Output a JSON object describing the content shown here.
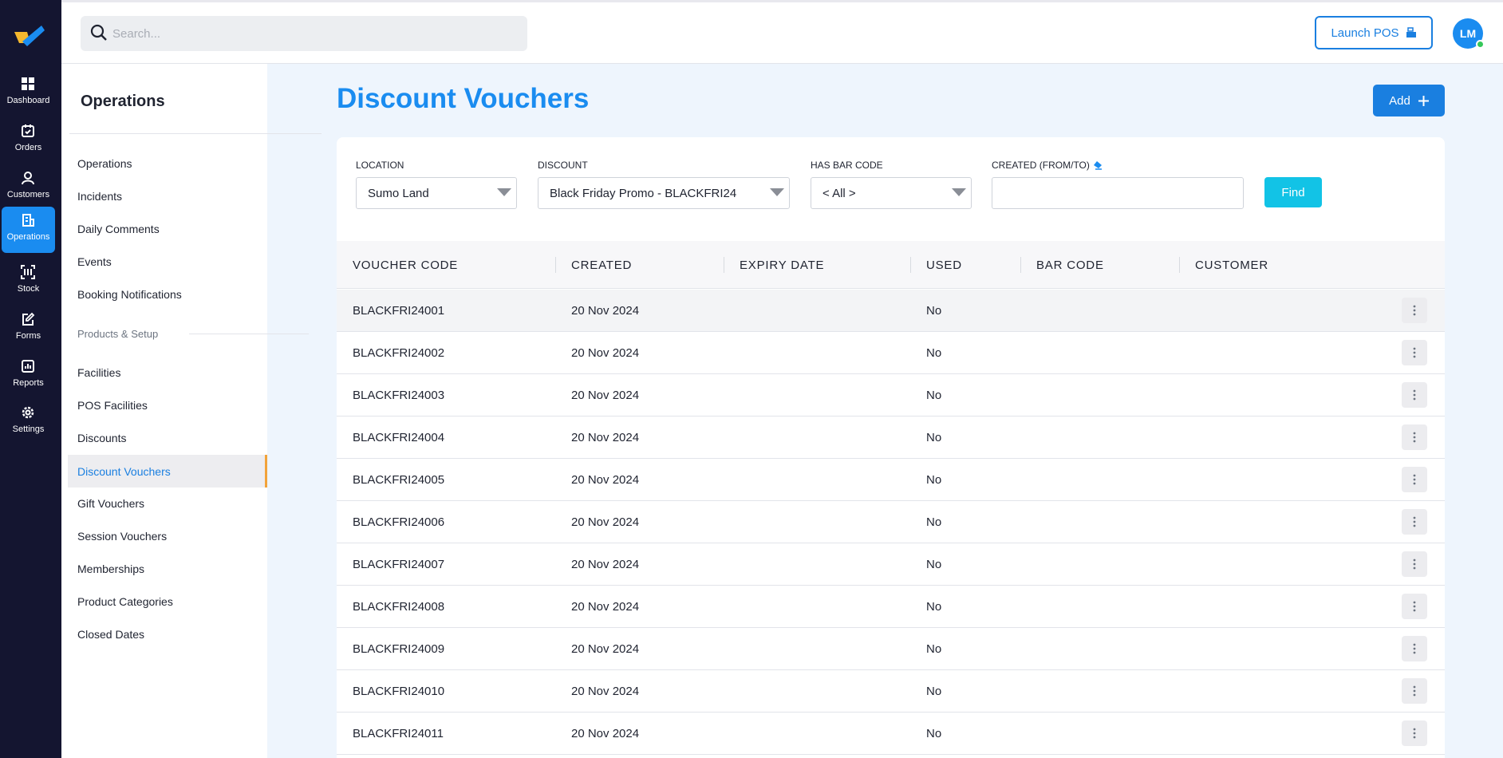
{
  "rail": {
    "items": [
      {
        "label": "Dashboard",
        "icon": "dashboard-icon"
      },
      {
        "label": "Orders",
        "icon": "orders-icon"
      },
      {
        "label": "Customers",
        "icon": "customers-icon"
      },
      {
        "label": "Operations",
        "icon": "operations-icon",
        "active": true
      },
      {
        "label": "Stock",
        "icon": "stock-icon"
      },
      {
        "label": "Forms",
        "icon": "forms-icon"
      },
      {
        "label": "Reports",
        "icon": "reports-icon"
      },
      {
        "label": "Settings",
        "icon": "settings-icon"
      }
    ]
  },
  "topbar": {
    "search_placeholder": "Search...",
    "launch_label": "Launch POS",
    "avatar_initials": "LM"
  },
  "subnav": {
    "title": "Operations",
    "items": [
      "Operations",
      "Incidents",
      "Daily Comments",
      "Events",
      "Booking Notifications"
    ],
    "section_label": "Products & Setup",
    "setup_items": [
      "Facilities",
      "POS Facilities",
      "Discounts",
      "Discount Vouchers",
      "Gift Vouchers",
      "Session Vouchers",
      "Memberships",
      "Product Categories",
      "Closed Dates"
    ],
    "active_item": "Discount Vouchers"
  },
  "main": {
    "title": "Discount Vouchers",
    "add_label": "Add"
  },
  "filters": {
    "location_label": "LOCATION",
    "location_value": "Sumo Land",
    "discount_label": "DISCOUNT",
    "discount_value": "Black Friday Promo - BLACKFRI24",
    "barcode_label": "HAS BAR CODE",
    "barcode_value": "< All >",
    "created_label": "CREATED (FROM/TO)",
    "created_value": "",
    "find_label": "Find"
  },
  "table": {
    "columns": [
      "VOUCHER CODE",
      "CREATED",
      "EXPIRY DATE",
      "USED",
      "BAR CODE",
      "CUSTOMER"
    ],
    "rows": [
      {
        "code": "BLACKFRI24001",
        "created": "20 Nov 2024",
        "expiry": "",
        "used": "No",
        "barcode": "",
        "customer": ""
      },
      {
        "code": "BLACKFRI24002",
        "created": "20 Nov 2024",
        "expiry": "",
        "used": "No",
        "barcode": "",
        "customer": ""
      },
      {
        "code": "BLACKFRI24003",
        "created": "20 Nov 2024",
        "expiry": "",
        "used": "No",
        "barcode": "",
        "customer": ""
      },
      {
        "code": "BLACKFRI24004",
        "created": "20 Nov 2024",
        "expiry": "",
        "used": "No",
        "barcode": "",
        "customer": ""
      },
      {
        "code": "BLACKFRI24005",
        "created": "20 Nov 2024",
        "expiry": "",
        "used": "No",
        "barcode": "",
        "customer": ""
      },
      {
        "code": "BLACKFRI24006",
        "created": "20 Nov 2024",
        "expiry": "",
        "used": "No",
        "barcode": "",
        "customer": ""
      },
      {
        "code": "BLACKFRI24007",
        "created": "20 Nov 2024",
        "expiry": "",
        "used": "No",
        "barcode": "",
        "customer": ""
      },
      {
        "code": "BLACKFRI24008",
        "created": "20 Nov 2024",
        "expiry": "",
        "used": "No",
        "barcode": "",
        "customer": ""
      },
      {
        "code": "BLACKFRI24009",
        "created": "20 Nov 2024",
        "expiry": "",
        "used": "No",
        "barcode": "",
        "customer": ""
      },
      {
        "code": "BLACKFRI24010",
        "created": "20 Nov 2024",
        "expiry": "",
        "used": "No",
        "barcode": "",
        "customer": ""
      },
      {
        "code": "BLACKFRI24011",
        "created": "20 Nov 2024",
        "expiry": "",
        "used": "No",
        "barcode": "",
        "customer": ""
      }
    ]
  },
  "colors": {
    "rail_bg": "#141530",
    "accent": "#1a8cf0",
    "find_button": "#12c3e6",
    "active_marker": "#f2a33a",
    "online": "#35c85a"
  }
}
